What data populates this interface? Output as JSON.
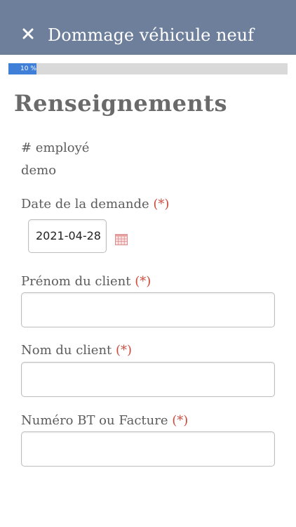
{
  "header": {
    "title": "Dommage véhicule neuf",
    "close_icon": "close-icon"
  },
  "progress": {
    "percent": 10,
    "label": "10 %",
    "fill_color": "#3f7fd8",
    "track_color": "#d9d9d9"
  },
  "section": {
    "title": "Renseignements"
  },
  "employee": {
    "label": "# employé",
    "value": "demo"
  },
  "fields": {
    "request_date": {
      "label": "Date de la demande",
      "required_mark": "(*)",
      "value": "2021-04-28"
    },
    "first_name": {
      "label": "Prénom du client",
      "required_mark": "(*)",
      "value": "",
      "placeholder": ""
    },
    "last_name": {
      "label": "Nom du client",
      "required_mark": "(*)",
      "value": "",
      "placeholder": ""
    },
    "invoice_number": {
      "label": "Numéro BT ou Facture",
      "required_mark": "(*)",
      "value": "",
      "placeholder": ""
    }
  },
  "colors": {
    "header_bg": "#6e7f9b",
    "required": "#cc4b3c"
  }
}
